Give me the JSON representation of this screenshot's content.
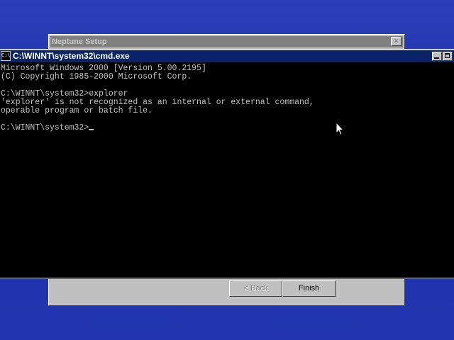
{
  "setup_window": {
    "title": "Neptune Setup",
    "close_glyph": "×",
    "back_label": "< Back",
    "finish_label": "Finish"
  },
  "cmd_window": {
    "title": "C:\\WINNT\\system32\\cmd.exe",
    "icon_text": "C:\\",
    "lines": [
      "Microsoft Windows 2000 [Version 5.00.2195]",
      "(C) Copyright 1985-2000 Microsoft Corp.",
      "",
      "C:\\WINNT\\system32>explorer",
      "'explorer' is not recognized as an internal or external command,",
      "operable program or batch file.",
      "",
      "C:\\WINNT\\system32>"
    ]
  },
  "colors": {
    "desktop": "#1c2fa6",
    "active_titlebar": "#0a246a",
    "console_bg": "#000000",
    "console_fg": "#c0c0c0"
  },
  "icons": [
    "console-app-icon",
    "minimize-icon",
    "maximize-icon",
    "close-icon",
    "mouse-pointer-icon"
  ]
}
